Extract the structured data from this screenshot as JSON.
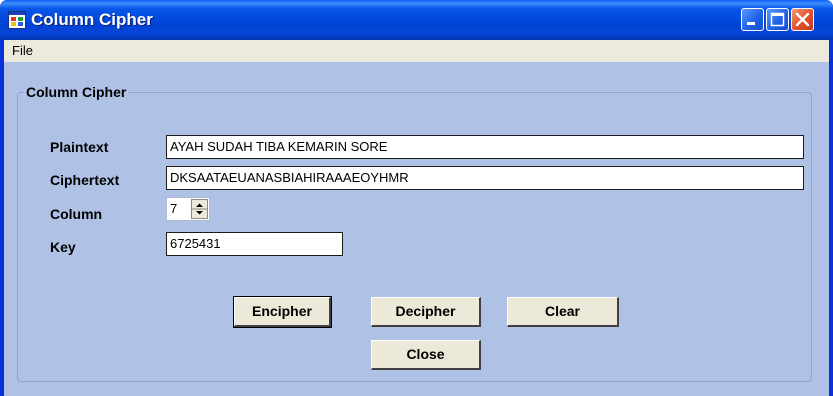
{
  "window": {
    "title": "Column Cipher"
  },
  "menu": {
    "file": "File"
  },
  "group": {
    "title": "Column Cipher"
  },
  "fields": {
    "plaintext_label": "Plaintext",
    "plaintext_value": "AYAH SUDAH TIBA KEMARIN SORE",
    "ciphertext_label": "Ciphertext",
    "ciphertext_value": "DKSAATAEUANASBIAHIRAAAEOYHMR",
    "column_label": "Column",
    "column_value": "7",
    "key_label": "Key",
    "key_value": "6725431"
  },
  "buttons": {
    "encipher": "Encipher",
    "decipher": "Decipher",
    "clear": "Clear",
    "close": "Close"
  },
  "colors": {
    "titlebar": "#0054e3",
    "client_bg": "#afc2e6",
    "close_button": "#e2502a"
  },
  "icons": [
    "app-icon",
    "minimize-icon",
    "maximize-icon",
    "close-icon",
    "spin-up-icon",
    "spin-down-icon"
  ]
}
